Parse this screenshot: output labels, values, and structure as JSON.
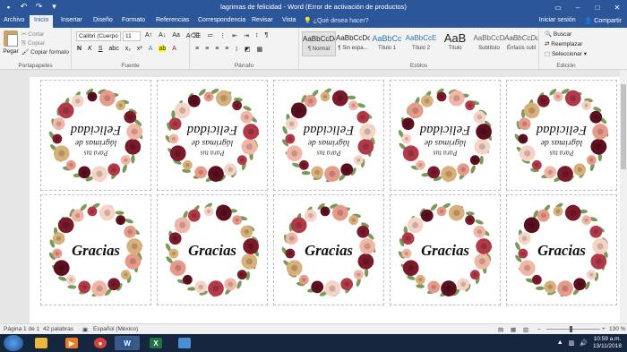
{
  "window": {
    "title": "lagrimas de felicidad - Word (Error de activación de productos)"
  },
  "tabs": [
    {
      "label": "Archivo"
    },
    {
      "label": "Inicio"
    },
    {
      "label": "Insertar"
    },
    {
      "label": "Diseño"
    },
    {
      "label": "Formato"
    },
    {
      "label": "Referencias"
    },
    {
      "label": "Correspondencia"
    },
    {
      "label": "Revisar"
    },
    {
      "label": "Vista"
    }
  ],
  "tell_me": "¿Qué desea hacer?",
  "account": {
    "signin": "Iniciar sesión",
    "share": "Compartir"
  },
  "ribbon": {
    "clipboard": {
      "paste": "Pegar",
      "cut": "Cortar",
      "copy": "Copiar",
      "format_painter": "Copiar formato",
      "label": "Portapapeles"
    },
    "font": {
      "family": "Calibri (Cuerpo",
      "size": "11",
      "label": "Fuente"
    },
    "paragraph": {
      "label": "Párrafo"
    },
    "styles": {
      "label": "Estilos",
      "items": [
        {
          "sample": "AaBbCcDc",
          "name": "¶ Normal"
        },
        {
          "sample": "AaBbCcDc",
          "name": "¶ Sin espa..."
        },
        {
          "sample": "AaBbCc",
          "name": "Título 1"
        },
        {
          "sample": "AaBbCcE",
          "name": "Título 2"
        },
        {
          "sample": "AaB",
          "name": "Título"
        },
        {
          "sample": "AaBbCcD",
          "name": "Subtítulo"
        },
        {
          "sample": "AaBbCcDu",
          "name": "Énfasis sutil"
        }
      ]
    },
    "editing": {
      "find": "Buscar",
      "replace": "Reemplazar",
      "select": "Seleccionar",
      "label": "Edición"
    }
  },
  "cards": {
    "top_line1": "Para tus",
    "top_line2": "lágrimas de",
    "top_line3": "Felicidad",
    "bottom_text": "Gracias"
  },
  "statusbar": {
    "page": "Página 1 de 1",
    "words": "42 palabras",
    "language": "Español (México)",
    "zoom": "130 %"
  },
  "taskbar": {
    "time": "10:59 a.m.",
    "date": "13/11/2018",
    "apps": [
      {
        "icon": "explorer-folder-icon",
        "color": "#e8b93b"
      },
      {
        "icon": "media-player-icon",
        "color": "#f07a1b"
      },
      {
        "icon": "chrome-icon",
        "color": "#d8413a"
      },
      {
        "icon": "word-icon",
        "color": "#2b579a",
        "letter": "W"
      },
      {
        "icon": "excel-icon",
        "color": "#217346",
        "letter": "X"
      },
      {
        "icon": "photos-icon",
        "color": "#4a8fd6"
      }
    ]
  },
  "colors": {
    "word_blue": "#2b579a",
    "burgundy": "#7a1a2a",
    "blush": "#f2b6a6",
    "leaf": "#7a9a5a"
  }
}
